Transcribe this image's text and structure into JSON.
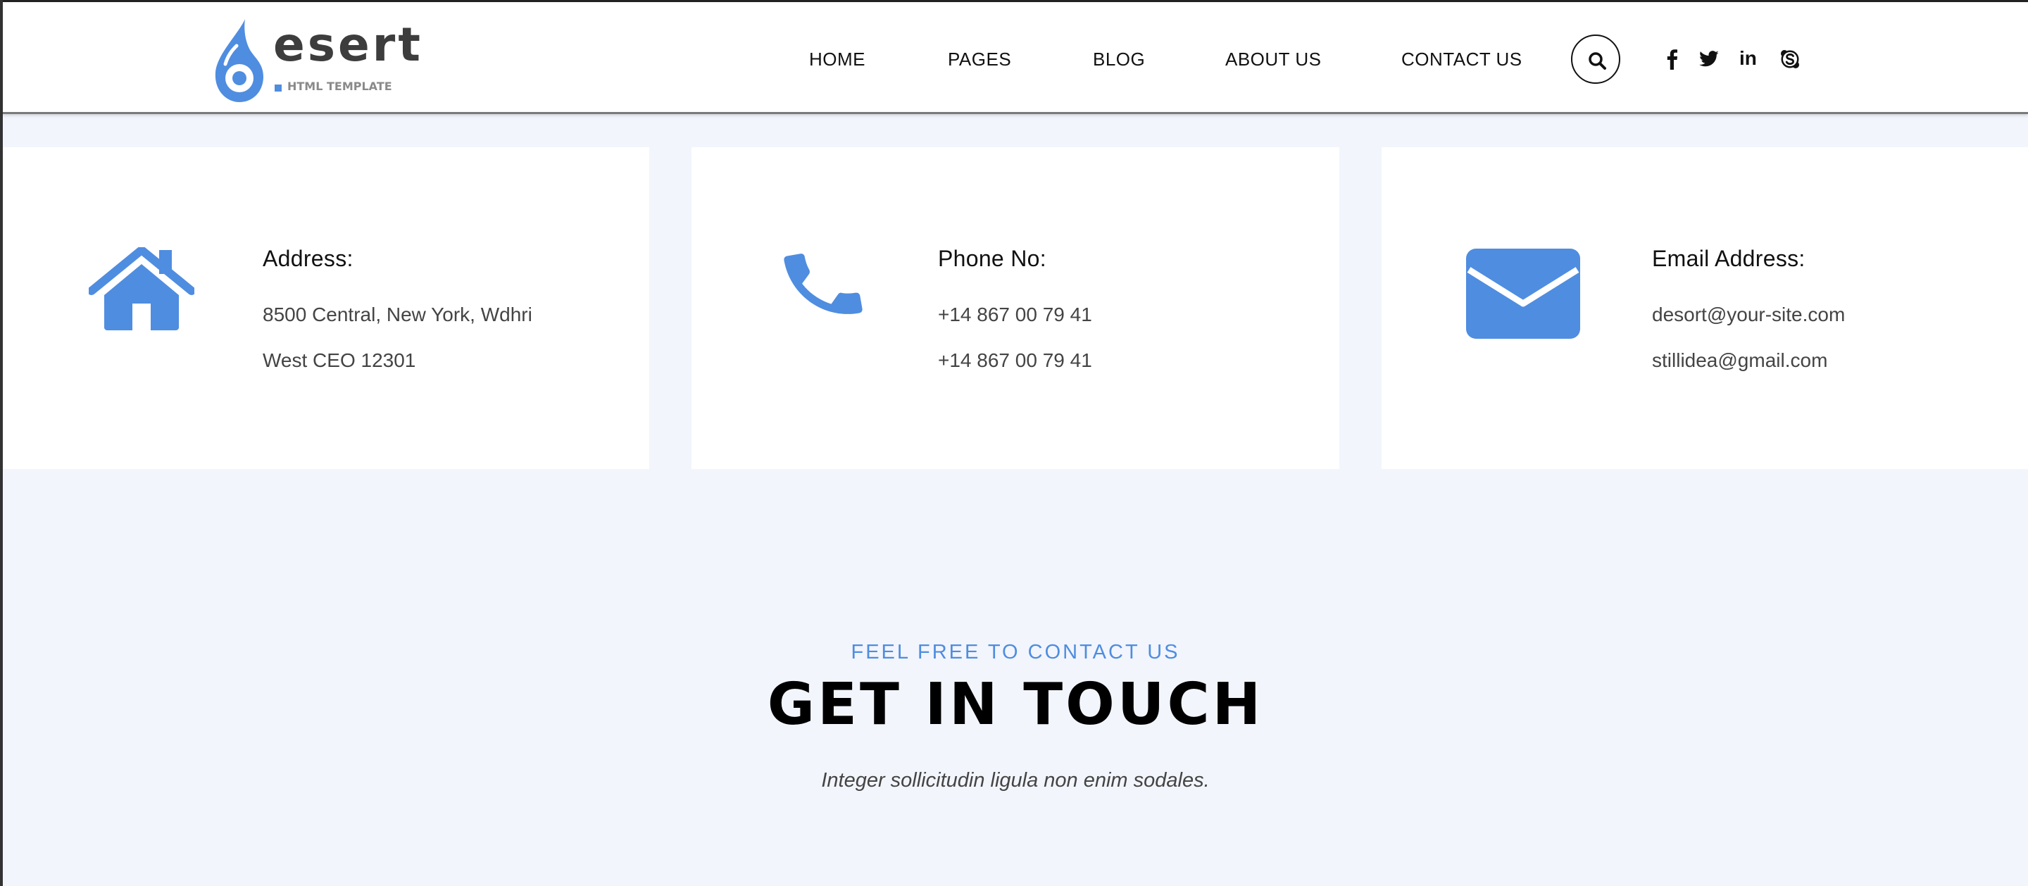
{
  "brand": {
    "name": "esert",
    "tagline": "HTML TEMPLATE",
    "accent": "#4f8de0"
  },
  "nav": {
    "items": [
      {
        "label": "HOME"
      },
      {
        "label": "PAGES"
      },
      {
        "label": "BLOG"
      },
      {
        "label": "ABOUT US"
      },
      {
        "label": "CONTACT US"
      }
    ],
    "search_icon": "search-icon",
    "social": [
      "facebook-icon",
      "twitter-icon",
      "linkedin-icon",
      "skype-icon"
    ],
    "linkedin_text": "in"
  },
  "info_cards": [
    {
      "icon": "house-icon",
      "title": "Address:",
      "lines": [
        "8500 Central, New York, Wdhri",
        "West CEO 12301"
      ]
    },
    {
      "icon": "phone-icon",
      "title": "Phone No:",
      "lines": [
        "+14 867 00 79 41",
        "+14 867 00 79 41"
      ]
    },
    {
      "icon": "envelope-icon",
      "title": "Email Address:",
      "lines": [
        "desort@your-site.com",
        "stillidea@gmail.com"
      ]
    }
  ],
  "contact": {
    "kicker": "FEEL FREE TO CONTACT US",
    "heading": "GET IN TOUCH",
    "subtext": "Integer sollicitudin ligula non enim sodales."
  },
  "colors": {
    "page_bg": "#f2f5fc",
    "card_bg": "#ffffff",
    "icon_blue": "#4f8de0",
    "heading": "#000000",
    "body_text": "#444444"
  }
}
